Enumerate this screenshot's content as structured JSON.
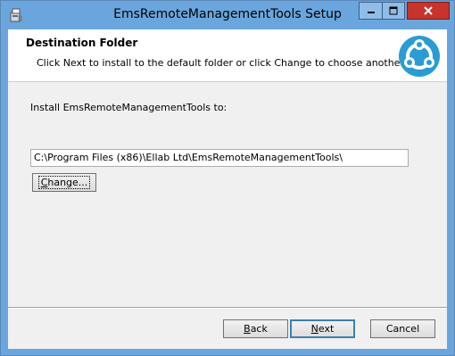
{
  "window": {
    "title": "EmsRemoteManagementTools Setup",
    "controls": {
      "minimize_icon": "minimize-icon",
      "maximize_icon": "maximize-icon",
      "close_icon": "close-icon",
      "close_color": "#c7342c"
    },
    "titlebar_color": "#6aa6dd"
  },
  "banner": {
    "title": "Destination Folder",
    "description": "Click Next to install to the default folder or click Change to choose another.",
    "logo_icon": "installer-logo-icon"
  },
  "main": {
    "install_label": "Install EmsRemoteManagementTools to:",
    "install_path": "C:\\Program Files (x86)\\Ellab Ltd\\EmsRemoteManagementTools\\",
    "change_button": {
      "accel": "C",
      "rest": "hange..."
    }
  },
  "footer": {
    "back_button": {
      "accel": "B",
      "rest": "ack"
    },
    "next_button": {
      "accel": "N",
      "rest": "ext"
    },
    "cancel_label": "Cancel"
  }
}
